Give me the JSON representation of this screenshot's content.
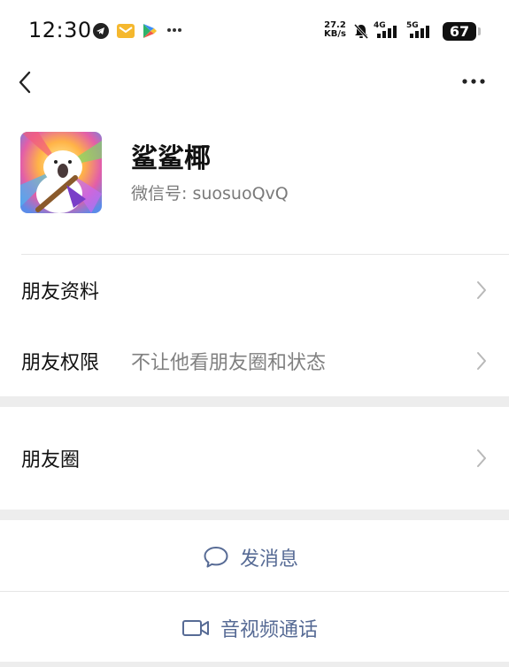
{
  "status_bar": {
    "time": "12:30",
    "net_speed_value": "27.2",
    "net_speed_unit": "KB/s",
    "signal1_label": "4G",
    "signal2_label": "5G",
    "battery": "67",
    "icons": [
      "telegram-icon",
      "mail-icon",
      "app-store-icon",
      "overflow-dots-icon",
      "mute-bell-icon",
      "signal-icon",
      "signal-icon",
      "battery-icon"
    ]
  },
  "navbar": {
    "back_icon": "chevron-left-icon",
    "more_icon": "more-dots-icon"
  },
  "profile": {
    "name": "鲨鲨椰",
    "wechat_id_label": "微信号:",
    "wechat_id": "suosuoQvQ"
  },
  "rows": [
    {
      "label": "朋友资料",
      "value": ""
    },
    {
      "label": "朋友权限",
      "value": "不让他看朋友圈和状态"
    },
    {
      "label": "朋友圈",
      "value": ""
    }
  ],
  "actions": {
    "message_label": "发消息",
    "call_label": "音视频通话"
  },
  "colors": {
    "link_blue": "#576b95",
    "gap_gray": "#ededed",
    "secondary_text": "#808080"
  }
}
